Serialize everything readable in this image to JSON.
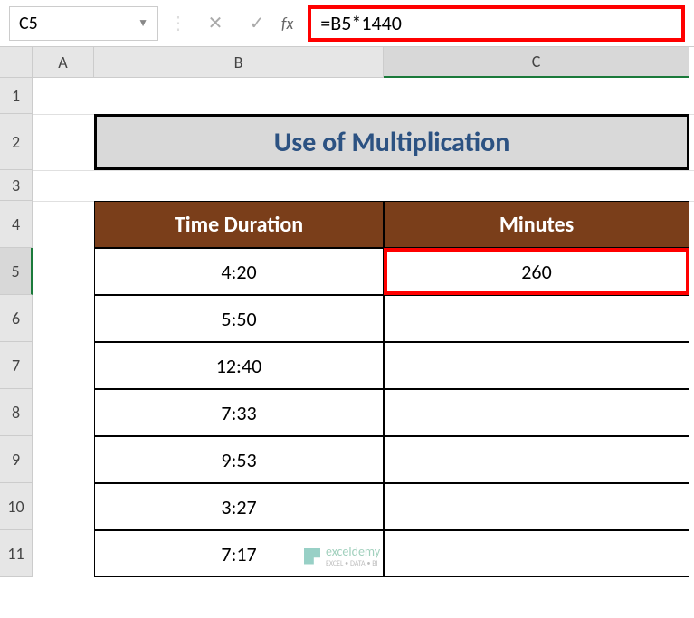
{
  "nameBox": {
    "value": "C5"
  },
  "formulaBar": {
    "formula": "=B5*1440",
    "fxLabel": "fx"
  },
  "columns": {
    "a": "A",
    "b": "B",
    "c": "C"
  },
  "rows": {
    "r1": "1",
    "r2": "2",
    "r3": "3",
    "r4": "4",
    "r5": "5",
    "r6": "6",
    "r7": "7",
    "r8": "8",
    "r9": "9",
    "r10": "10",
    "r11": "11"
  },
  "title": "Use of Multiplication",
  "tableHeaders": {
    "b": "Time Duration",
    "c": "Minutes"
  },
  "tableData": {
    "b5": "4:20",
    "c5": "260",
    "b6": "5:50",
    "c6": "",
    "b7": "12:40",
    "c7": "",
    "b8": "7:33",
    "c8": "",
    "b9": "9:53",
    "c9": "",
    "b10": "3:27",
    "c10": "",
    "b11": "7:17",
    "c11": ""
  },
  "watermark": {
    "brand": "exceldemy",
    "tagline": "EXCEL • DATA • BI"
  }
}
